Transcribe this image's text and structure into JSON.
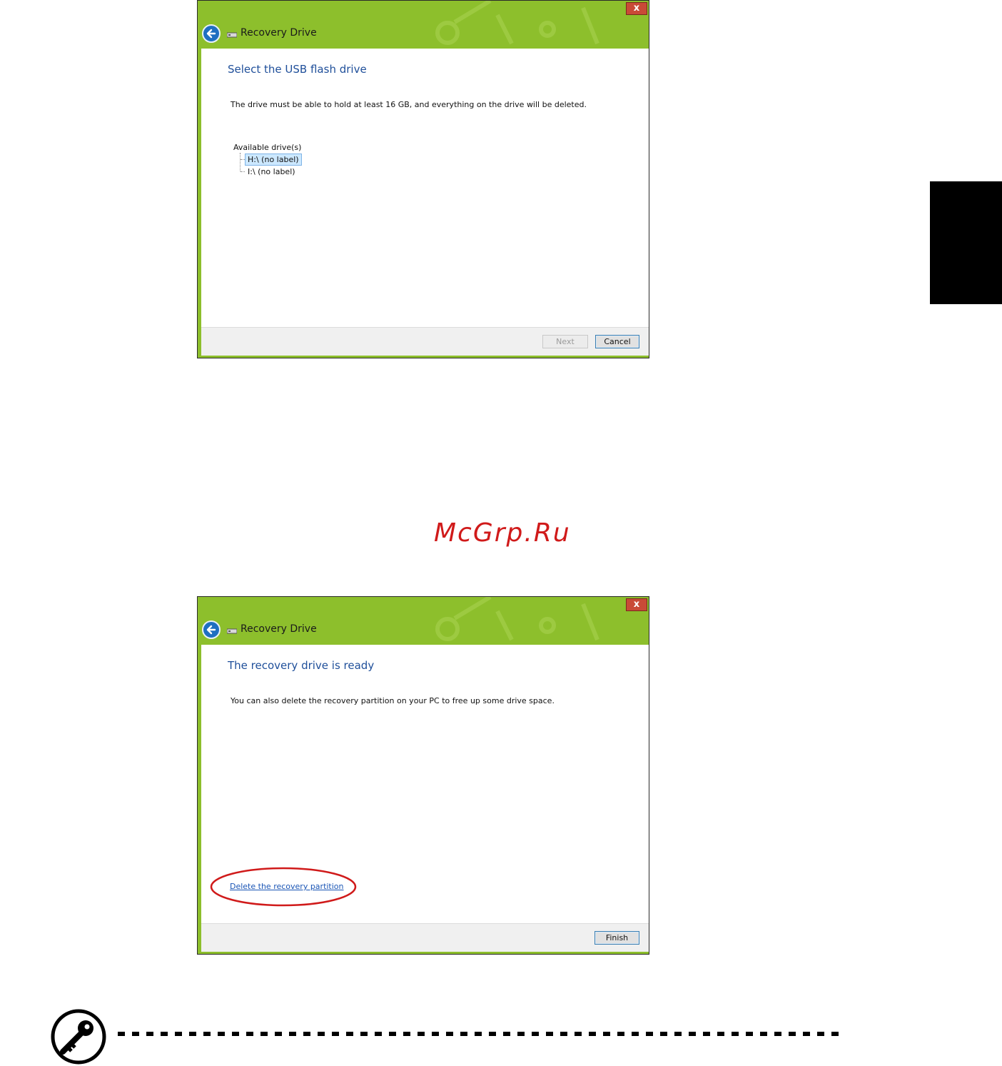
{
  "colors": {
    "titlebar": "#8dbf2c",
    "heading": "#1f4f9a",
    "link": "#1a55b5",
    "highlight": "#d01a1a",
    "selection": "#cce8ff"
  },
  "window1": {
    "title": "Recovery Drive",
    "close_label": "x",
    "heading": "Select the USB flash drive",
    "description": "The drive must be able to hold at least 16 GB, and everything on the drive will be deleted.",
    "tree_label": "Available drive(s)",
    "drives": [
      "H:\\ (no label)",
      "I:\\ (no label)"
    ],
    "selected_drive": "H:\\ (no label)",
    "next_label": "Next",
    "cancel_label": "Cancel"
  },
  "watermark": "McGrp.Ru",
  "window2": {
    "title": "Recovery Drive",
    "close_label": "x",
    "heading": "The recovery drive is ready",
    "description": "You can also delete the recovery partition on your PC to free up some drive space.",
    "delete_link": "Delete the recovery partition",
    "finish_label": "Finish"
  },
  "icons": {
    "back": "back-arrow-icon",
    "drive": "usb-drive-icon",
    "close": "close-icon",
    "key": "key-icon"
  }
}
